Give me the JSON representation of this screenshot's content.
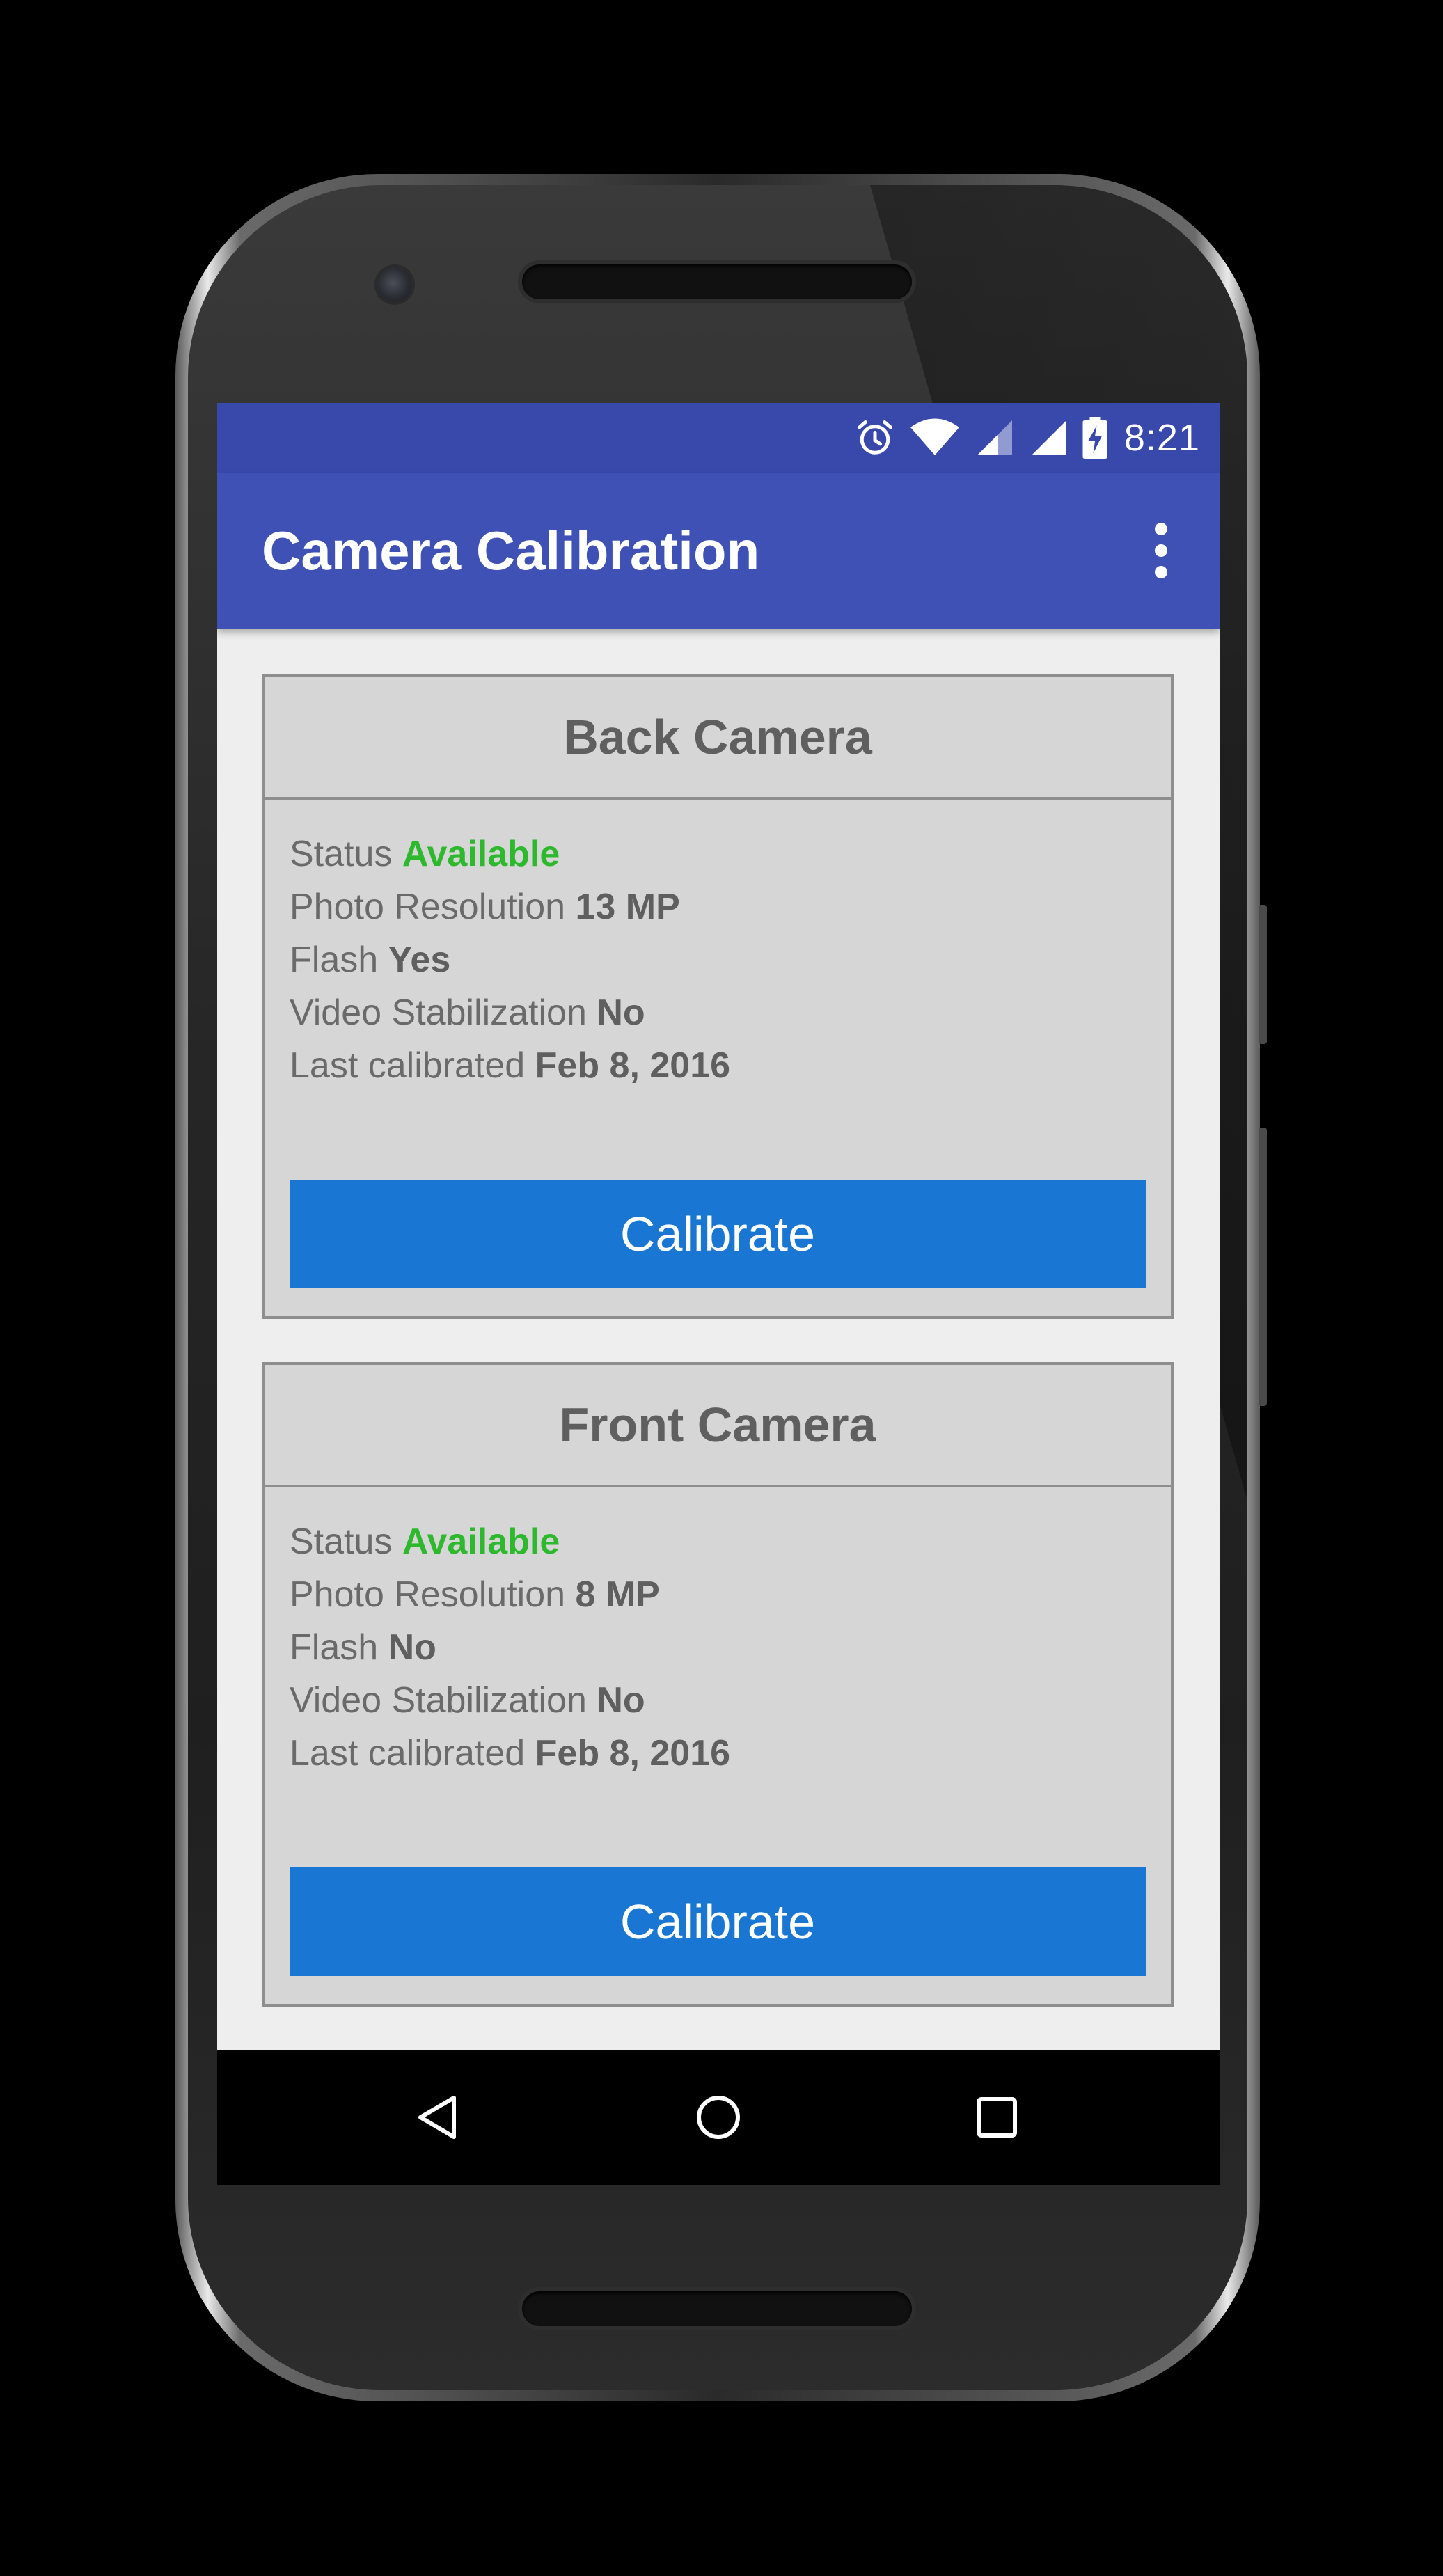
{
  "status_bar": {
    "time": "8:21",
    "icons": [
      "alarm-icon",
      "wifi-icon",
      "signal-icon",
      "signal-icon",
      "battery-charging-icon"
    ]
  },
  "app_bar": {
    "title": "Camera Calibration",
    "overflow_icon": "more-vert-icon"
  },
  "cameras": [
    {
      "name": "Back Camera",
      "details": [
        {
          "label": "Status",
          "value": "Available"
        },
        {
          "label": "Photo Resolution",
          "value": "13 MP"
        },
        {
          "label": "Flash",
          "value": "Yes"
        },
        {
          "label": "Video Stabilization",
          "value": "No"
        },
        {
          "label": "Last calibrated",
          "value": "Feb 8, 2016"
        }
      ],
      "button_label": "Calibrate"
    },
    {
      "name": "Front Camera",
      "details": [
        {
          "label": "Status",
          "value": "Available"
        },
        {
          "label": "Photo Resolution",
          "value": "8 MP"
        },
        {
          "label": "Flash",
          "value": "No"
        },
        {
          "label": "Video Stabilization",
          "value": "No"
        },
        {
          "label": "Last calibrated",
          "value": "Feb 8, 2016"
        }
      ],
      "button_label": "Calibrate"
    }
  ],
  "nav_bar": {
    "icons": [
      "back-icon",
      "home-icon",
      "recents-icon"
    ]
  },
  "colors": {
    "status_bar": "#3949AB",
    "app_bar": "#3F51B5",
    "button": "#1976D2",
    "available": "#2DB82D",
    "card": "#D6D6D6"
  }
}
